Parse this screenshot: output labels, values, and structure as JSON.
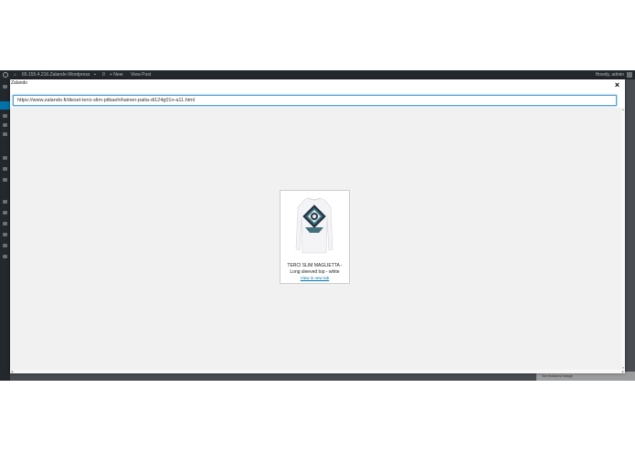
{
  "adminbar": {
    "site": "65.155.4.216.Zalando-Wordpress",
    "new_label": "+ New",
    "view_post": "View Post",
    "howdy": "Howdy, admin"
  },
  "backpage": {
    "publish_label": "Set featured image"
  },
  "modal": {
    "title": "Zalando",
    "close_label": "×",
    "url_value": "https://www.zalando.fi/diesel-terci-slim-pitkaehihainen-paita-di124g01n-a11.html"
  },
  "product": {
    "title_line1": "TERCI SLIM MAGLIETTA -",
    "title_line2": "Long sleeved top - white",
    "link_label": "View in new tab"
  },
  "colors": {
    "accent": "#0073aa",
    "admin_dark": "#23282d"
  }
}
